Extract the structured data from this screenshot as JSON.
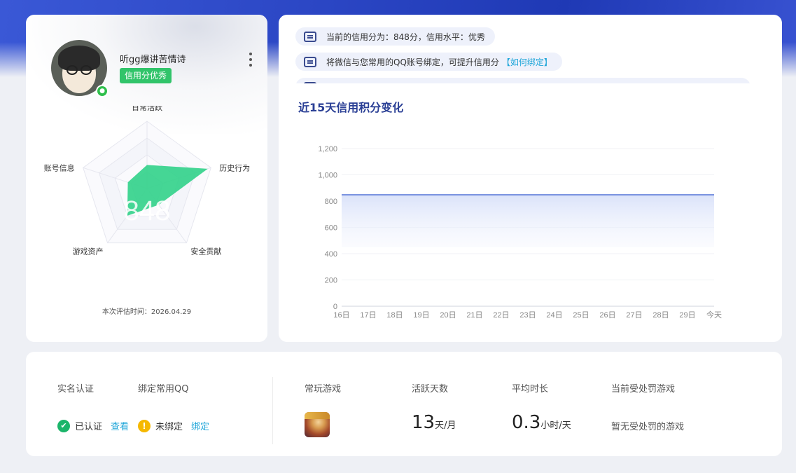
{
  "profile": {
    "username": "听gg爆讲苦情诗",
    "credit_badge": "信用分优秀",
    "score": "848",
    "radar_axes": [
      "日常活跃",
      "历史行为",
      "安全贡献",
      "游戏资产",
      "账号信息"
    ],
    "radar_values": [
      0.35,
      0.95,
      0.3,
      0.5,
      0.3
    ],
    "eval_time": "本次评估时间：2026.04.29",
    "colors": {
      "radar_fill": "#31d18a",
      "badge": "#31c46a"
    }
  },
  "notices": [
    {
      "text": "当前的信用分为：848分，信用水平：优秀",
      "link": ""
    },
    {
      "text": "将微信与您常用的QQ账号绑定，可提升信用分",
      "link": "【如何绑定】"
    }
  ],
  "chart_title": "近15天信用积分变化",
  "chart_data": {
    "type": "area",
    "x": [
      "16日",
      "17日",
      "18日",
      "19日",
      "20日",
      "21日",
      "22日",
      "23日",
      "24日",
      "25日",
      "26日",
      "27日",
      "28日",
      "29日",
      "今天"
    ],
    "values": [
      848,
      848,
      848,
      848,
      848,
      848,
      848,
      848,
      848,
      848,
      848,
      848,
      848,
      848,
      848
    ],
    "yticks": [
      "0",
      "200",
      "400",
      "600",
      "800",
      "1,000",
      "1,200"
    ],
    "ylim": [
      0,
      1200
    ],
    "grid": true,
    "colors": {
      "line": "#7b93e0",
      "fill": "#dfe6fa"
    }
  },
  "stats": {
    "labels": {
      "realname": "实名认证",
      "bind_qq": "绑定常用QQ",
      "games": "常玩游戏",
      "active_days": "活跃天数",
      "avg_time": "平均时长",
      "punished": "当前受处罚游戏"
    },
    "realname_status": "已认证",
    "realname_action": "查看",
    "qq_status": "未绑定",
    "qq_action": "绑定",
    "active_days_value": "13",
    "active_days_unit": "天/月",
    "avg_time_value": "0.3",
    "avg_time_unit": "小时/天",
    "punished_text": "暂无受处罚的游戏",
    "game_icon": "honor-of-kings-hero-icon"
  }
}
